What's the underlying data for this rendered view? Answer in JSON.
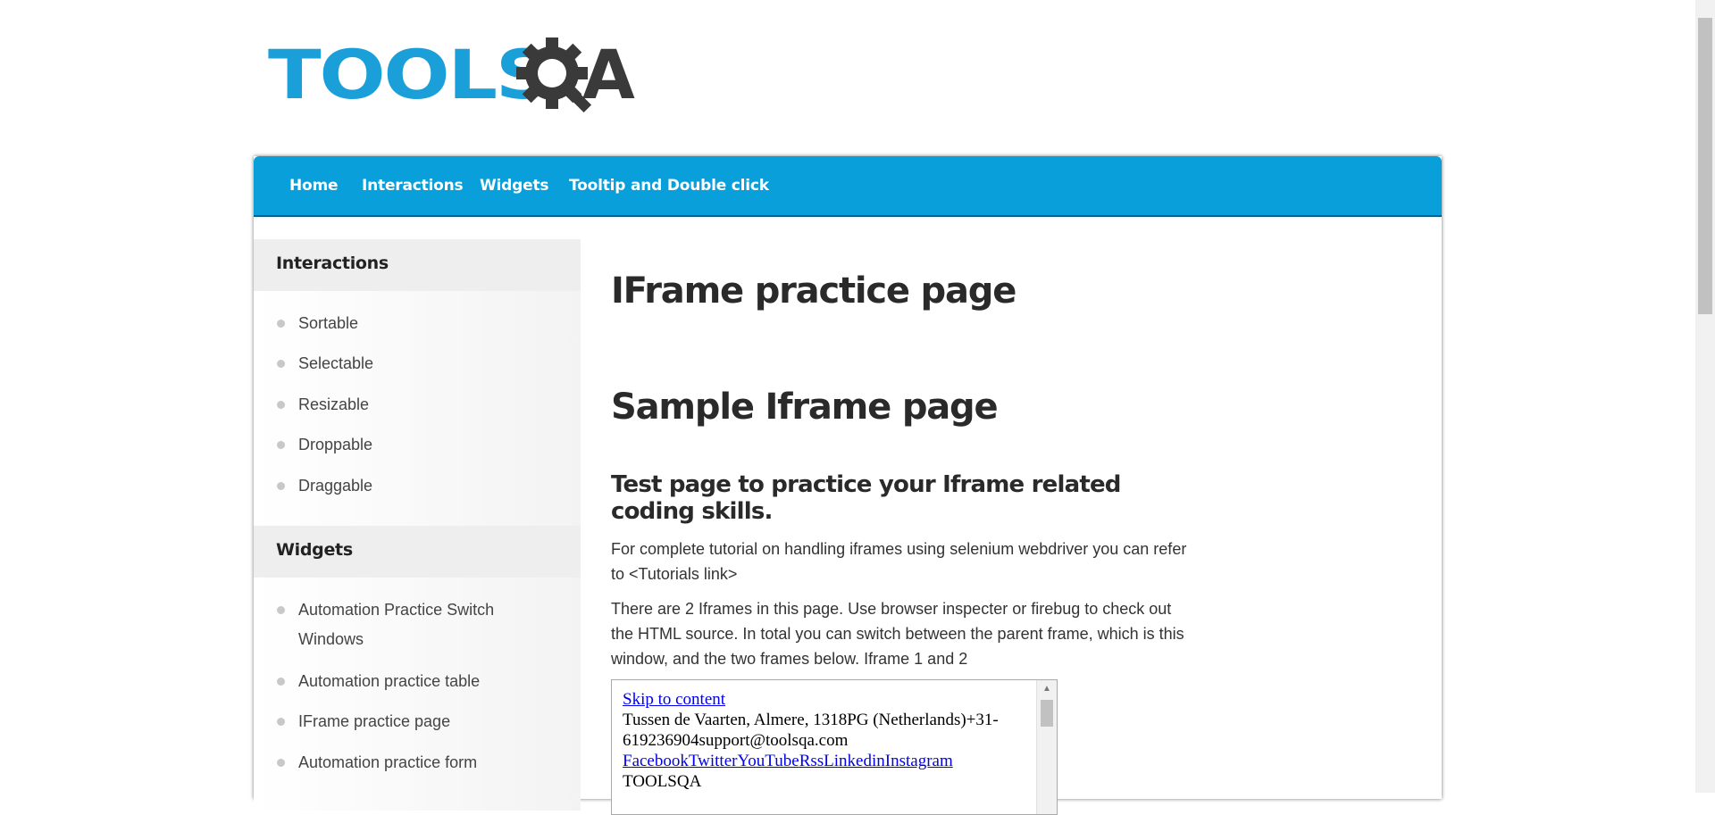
{
  "logo": {
    "text_tools": "TOOLS",
    "text_qa": "A"
  },
  "nav": {
    "items": [
      "Home",
      "Interactions",
      "Widgets",
      "Tooltip and Double click"
    ]
  },
  "sidebar": {
    "sections": [
      {
        "title": "Interactions",
        "items": [
          "Sortable",
          "Selectable",
          "Resizable",
          "Droppable",
          "Draggable"
        ]
      },
      {
        "title": "Widgets",
        "items": [
          "Automation Practice Switch Windows",
          "Automation practice table",
          "IFrame practice page",
          "Automation practice form"
        ]
      }
    ]
  },
  "main": {
    "title": "IFrame practice page",
    "heading": "Sample Iframe page",
    "subheading": "Test page to practice your Iframe related coding skills.",
    "paragraph1": "For complete tutorial on handling iframes using selenium webdriver you can refer to <Tutorials link>",
    "paragraph2": "There are 2 Iframes in this page. Use browser inspecter or firebug to check out the HTML source. In total you can switch between the parent frame, which is this window, and the two frames below. Iframe 1 and 2"
  },
  "iframe": {
    "skip_link": "Skip to content",
    "address": "Tussen de Vaarten, Almere, 1318PG (Netherlands)+31-619236904support@toolsqa.com",
    "social_links": [
      "Facebook",
      "Twitter",
      "YouTube",
      "Rss",
      "Linkedin",
      "Instagram"
    ],
    "brand": "TOOLSQA"
  },
  "colors": {
    "nav_bg": "#089fdb",
    "logo_blue": "#1a9fd9",
    "logo_dark": "#3a3a3a"
  }
}
